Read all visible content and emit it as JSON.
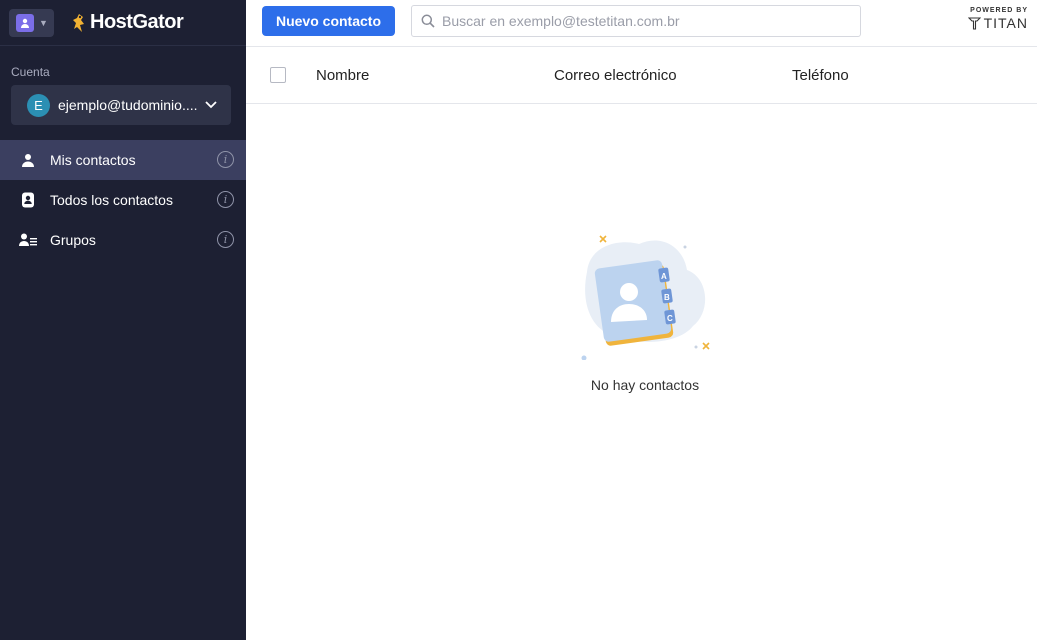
{
  "app": {
    "brand": "HostGator",
    "switcher_icon": "contacts-app-icon",
    "powered_by": "POWERED BY",
    "provider": "TITAN"
  },
  "sidebar": {
    "account_label": "Cuenta",
    "account_initial": "E",
    "account_email": "ejemplo@tudominio....",
    "items": [
      {
        "label": "Mis contactos",
        "icon": "person-icon",
        "active": true
      },
      {
        "label": "Todos los contactos",
        "icon": "contact-book-icon",
        "active": false
      },
      {
        "label": "Grupos",
        "icon": "group-list-icon",
        "active": false
      }
    ]
  },
  "toolbar": {
    "new_contact_label": "Nuevo contacto",
    "search_placeholder": "Buscar en exemplo@testetitan.com.br"
  },
  "table": {
    "columns": [
      "Nombre",
      "Correo electrónico",
      "Teléfono"
    ]
  },
  "empty_state": {
    "message": "No hay contactos",
    "tabs": [
      "A",
      "B",
      "C"
    ]
  },
  "colors": {
    "sidebar_bg": "#1d2033",
    "active_item": "#3b3f60",
    "primary": "#2d6eea",
    "avatar": "#2b8fb3"
  }
}
